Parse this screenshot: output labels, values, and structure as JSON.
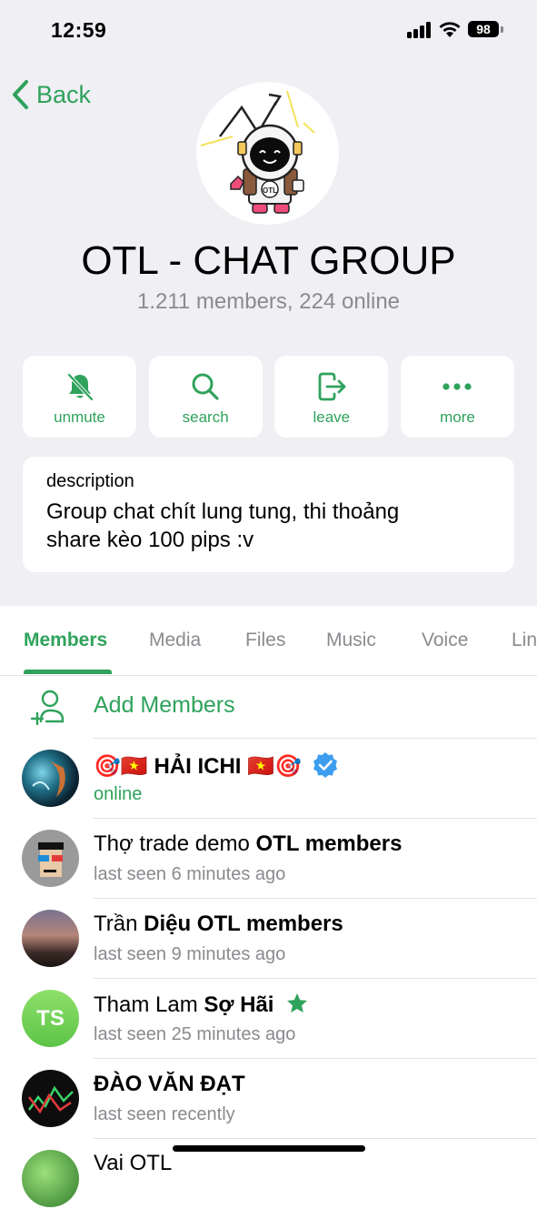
{
  "status_bar": {
    "time": "12:59",
    "battery": "98"
  },
  "nav": {
    "back_label": "Back"
  },
  "group": {
    "title": "OTL - CHAT GROUP",
    "subtitle": "1.211 members, 224 online",
    "avatar_text": "OTL"
  },
  "actions": [
    {
      "label": "unmute",
      "icon": "bell-slash-icon"
    },
    {
      "label": "search",
      "icon": "search-icon"
    },
    {
      "label": "leave",
      "icon": "leave-icon"
    },
    {
      "label": "more",
      "icon": "more-icon"
    }
  ],
  "description": {
    "label": "description",
    "text_line1": "Group chat chít lung tung, thi thoảng",
    "text_line2": "share kèo 100 pips :v"
  },
  "tabs": [
    "Members",
    "Media",
    "Files",
    "Music",
    "Voice",
    "Links"
  ],
  "add_members": {
    "label": "Add Members"
  },
  "members": [
    {
      "name_pre": "🎯🇻🇳 ",
      "name_bold": "HẢI ICHI",
      "name_post": " 🇻🇳🎯",
      "status": "online",
      "verified": true
    },
    {
      "name_normal": "Thợ trade demo ",
      "name_bold": "OTL members",
      "status": "last seen 6 minutes ago"
    },
    {
      "name_normal": "Trần ",
      "name_bold": "Diệu OTL members",
      "status": "last seen 9 minutes ago"
    },
    {
      "name_normal": "Tham Lam ",
      "name_bold": "Sợ Hãi",
      "status": "last seen 25 minutes ago",
      "initials": "TS",
      "star": true
    },
    {
      "name_bold": "ĐÀO VĂN ĐẠT",
      "status": "last seen recently"
    },
    {
      "name_normal": "Vai OTL"
    }
  ],
  "colors": {
    "accent": "#2fa25c",
    "secondary_text": "#8a8a8f",
    "background": "#efeff4"
  }
}
